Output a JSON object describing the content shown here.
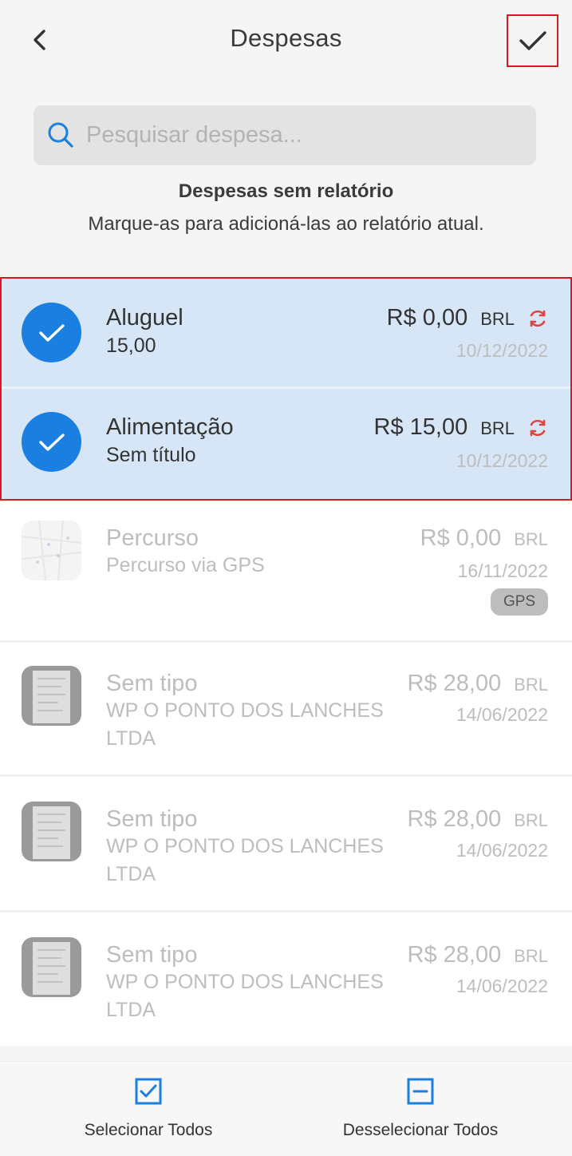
{
  "header": {
    "title": "Despesas"
  },
  "search": {
    "placeholder": "Pesquisar despesa..."
  },
  "section": {
    "title": "Despesas sem relatório",
    "subtitle": "Marque-as para adicioná-las ao relatório atual."
  },
  "expenses": [
    {
      "name": "Aluguel",
      "sub": "15,00",
      "amount": "R$ 0,00",
      "currency": "BRL",
      "date": "10/12/2022",
      "selected": true
    },
    {
      "name": "Alimentação",
      "sub": "Sem título",
      "amount": "R$ 15,00",
      "currency": "BRL",
      "date": "10/12/2022",
      "selected": true
    },
    {
      "name": "Percurso",
      "sub": "Percurso via GPS",
      "amount": "R$ 0,00",
      "currency": "BRL",
      "date": "16/11/2022",
      "badge": "GPS",
      "selected": false
    },
    {
      "name": "Sem tipo",
      "sub": "WP O PONTO DOS LANCHES LTDA",
      "amount": "R$ 28,00",
      "currency": "BRL",
      "date": "14/06/2022",
      "selected": false
    },
    {
      "name": "Sem tipo",
      "sub": "WP O PONTO DOS LANCHES LTDA",
      "amount": "R$ 28,00",
      "currency": "BRL",
      "date": "14/06/2022",
      "selected": false
    },
    {
      "name": "Sem tipo",
      "sub": "WP O PONTO DOS LANCHES LTDA",
      "amount": "R$ 28,00",
      "currency": "BRL",
      "date": "14/06/2022",
      "selected": false
    }
  ],
  "bottom": {
    "select_all": "Selecionar Todos",
    "deselect_all": "Desselecionar Todos"
  },
  "colors": {
    "accent": "#1a7fe0",
    "selected_bg": "#d6e6f6",
    "sync": "#e0443c",
    "highlight_border": "#d71920"
  }
}
